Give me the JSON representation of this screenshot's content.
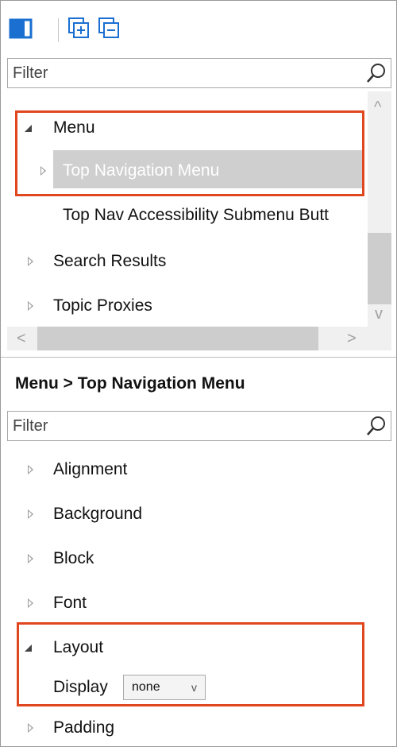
{
  "toolbar": {
    "buttons": [
      {
        "name": "layout-toggle-icon"
      },
      {
        "name": "expand-all-icon"
      },
      {
        "name": "collapse-all-icon"
      }
    ]
  },
  "top_filter": {
    "placeholder": "Filter"
  },
  "tree": {
    "items": [
      {
        "label": "Menu",
        "state": "expanded"
      },
      {
        "label": "Top Navigation Menu",
        "state": "collapsed",
        "selected": true
      },
      {
        "label": "Top Nav Accessibility Submenu Butt",
        "state": "leaf"
      },
      {
        "label": "Search Results",
        "state": "collapsed"
      },
      {
        "label": "Topic Proxies",
        "state": "collapsed"
      }
    ]
  },
  "scroll_arrows": {
    "up": "^",
    "down": "v",
    "left": "<",
    "right": ">"
  },
  "breadcrumb": "Menu > Top Navigation Menu",
  "property_filter": {
    "placeholder": "Filter"
  },
  "properties": {
    "groups": [
      {
        "label": "Alignment",
        "state": "collapsed"
      },
      {
        "label": "Background",
        "state": "collapsed"
      },
      {
        "label": "Block",
        "state": "collapsed"
      },
      {
        "label": "Font",
        "state": "collapsed"
      },
      {
        "label": "Layout",
        "state": "expanded"
      },
      {
        "label": "Padding",
        "state": "collapsed"
      }
    ],
    "layout": {
      "display_label": "Display",
      "display_value": "none",
      "display_caret": "v"
    }
  },
  "colors": {
    "highlight": "#e0471f",
    "selected_row": "#cfcfcf",
    "accent_blue": "#1a6fd1"
  }
}
